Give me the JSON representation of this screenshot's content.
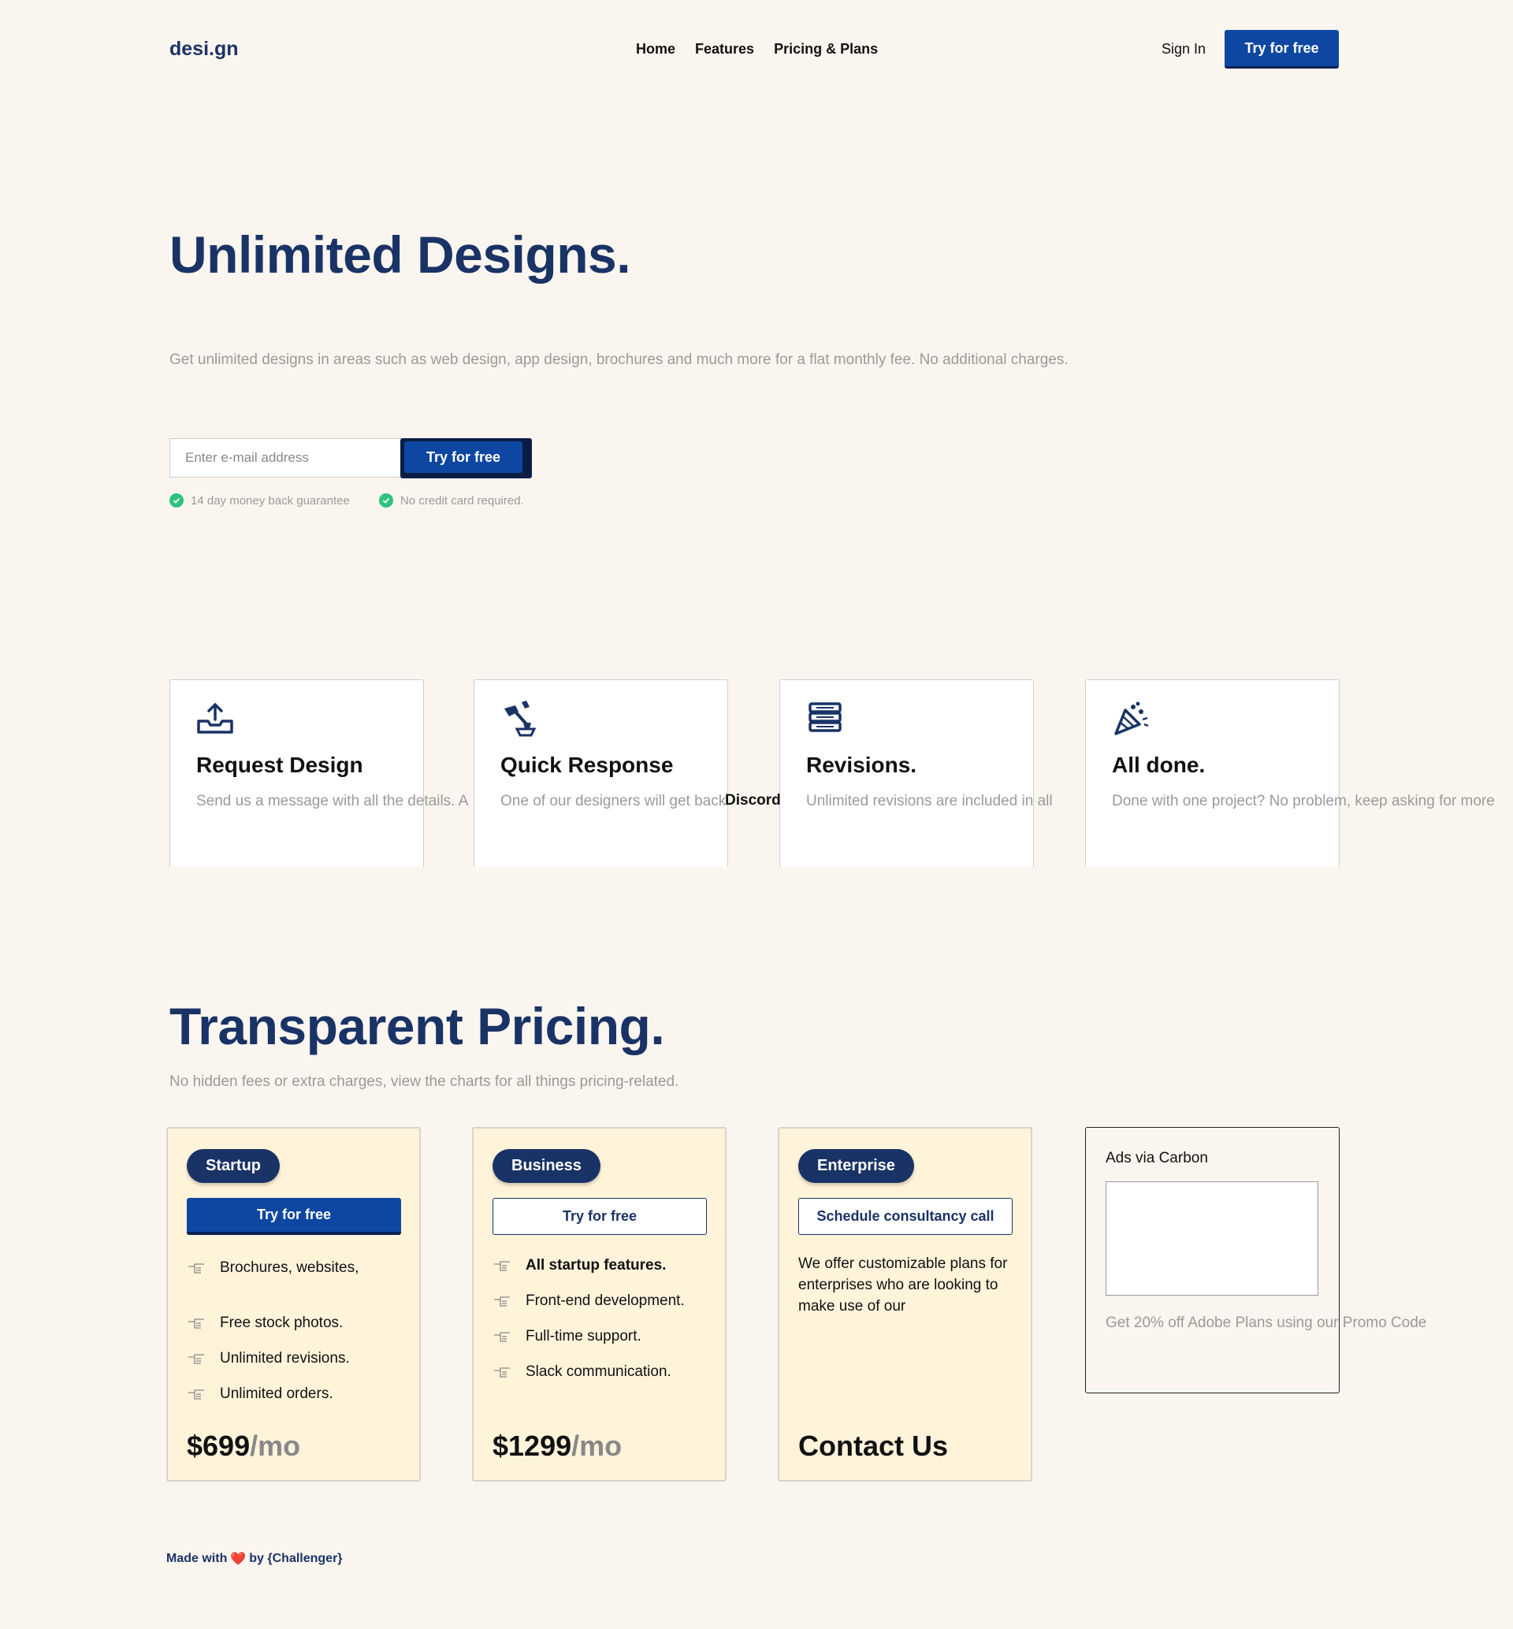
{
  "nav": {
    "logo": "desi.gn",
    "links": [
      "Home",
      "Features",
      "Pricing & Plans"
    ],
    "sign_in": "Sign In",
    "cta": "Try for free"
  },
  "hero": {
    "title": "Unlimited Designs.",
    "subtitle": "Get unlimited designs in areas such as web design, app design, brochures and much more for a flat monthly fee. No additional charges.",
    "email_placeholder": "Enter e-mail address",
    "cta": "Try for free",
    "guarantees": [
      "14 day money back guarantee",
      "No credit card required."
    ]
  },
  "steps": [
    {
      "title": "Request Design",
      "text": "Send us a message with all the details. A",
      "icon": "inbox-upload-icon"
    },
    {
      "title": "Quick Response",
      "text": "One of our designers will get back",
      "overflow": "Discord",
      "icon": "hammer-anvil-icon"
    },
    {
      "title": "Revisions.",
      "text": "Unlimited revisions are included in all",
      "icon": "stack-icon"
    },
    {
      "title": "All done.",
      "text": "Done with one project? No problem, keep asking for more",
      "icon": "party-popper-icon"
    }
  ],
  "pricing": {
    "title": "Transparent Pricing.",
    "subtitle": "No hidden fees or extra charges, view the charts for all things pricing-related.",
    "plans": [
      {
        "name": "Startup",
        "button": "Try for free",
        "features": [
          "Brochures, websites,",
          "Free stock photos.",
          "Unlimited revisions.",
          "Unlimited orders."
        ],
        "price": "$699",
        "period": "/mo"
      },
      {
        "name": "Business",
        "button": "Try for free",
        "features": [
          "All startup features.",
          "Front-end development.",
          "Full-time support.",
          "Slack communication."
        ],
        "price": "$1299",
        "period": "/mo"
      },
      {
        "name": "Enterprise",
        "button": "Schedule consultancy call",
        "description": "We offer customizable plans for enterprises who are looking to make use of our",
        "price": "Contact Us"
      }
    ]
  },
  "ad": {
    "title": "Ads via Carbon",
    "text": "Get 20% off Adobe Plans using our Promo Code"
  },
  "footer": {
    "made_with": "Made with",
    "heart": "❤️",
    "by": "by {Challenger}"
  },
  "colors": {
    "background": "#faf6ef",
    "brand_navy": "#1a3366",
    "button_blue": "#0d47a1",
    "plan_bg": "#fff3da",
    "check_green": "#2ec27e"
  }
}
